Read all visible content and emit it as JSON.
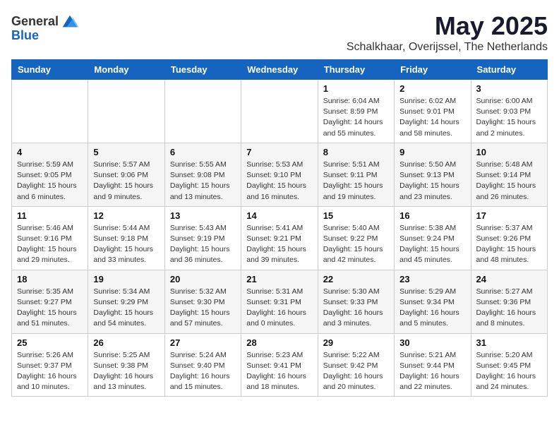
{
  "header": {
    "logo_general": "General",
    "logo_blue": "Blue",
    "month": "May 2025",
    "location": "Schalkhaar, Overijssel, The Netherlands"
  },
  "weekdays": [
    "Sunday",
    "Monday",
    "Tuesday",
    "Wednesday",
    "Thursday",
    "Friday",
    "Saturday"
  ],
  "weeks": [
    [
      {
        "day": "",
        "info": ""
      },
      {
        "day": "",
        "info": ""
      },
      {
        "day": "",
        "info": ""
      },
      {
        "day": "",
        "info": ""
      },
      {
        "day": "1",
        "info": "Sunrise: 6:04 AM\nSunset: 8:59 PM\nDaylight: 14 hours\nand 55 minutes."
      },
      {
        "day": "2",
        "info": "Sunrise: 6:02 AM\nSunset: 9:01 PM\nDaylight: 14 hours\nand 58 minutes."
      },
      {
        "day": "3",
        "info": "Sunrise: 6:00 AM\nSunset: 9:03 PM\nDaylight: 15 hours\nand 2 minutes."
      }
    ],
    [
      {
        "day": "4",
        "info": "Sunrise: 5:59 AM\nSunset: 9:05 PM\nDaylight: 15 hours\nand 6 minutes."
      },
      {
        "day": "5",
        "info": "Sunrise: 5:57 AM\nSunset: 9:06 PM\nDaylight: 15 hours\nand 9 minutes."
      },
      {
        "day": "6",
        "info": "Sunrise: 5:55 AM\nSunset: 9:08 PM\nDaylight: 15 hours\nand 13 minutes."
      },
      {
        "day": "7",
        "info": "Sunrise: 5:53 AM\nSunset: 9:10 PM\nDaylight: 15 hours\nand 16 minutes."
      },
      {
        "day": "8",
        "info": "Sunrise: 5:51 AM\nSunset: 9:11 PM\nDaylight: 15 hours\nand 19 minutes."
      },
      {
        "day": "9",
        "info": "Sunrise: 5:50 AM\nSunset: 9:13 PM\nDaylight: 15 hours\nand 23 minutes."
      },
      {
        "day": "10",
        "info": "Sunrise: 5:48 AM\nSunset: 9:14 PM\nDaylight: 15 hours\nand 26 minutes."
      }
    ],
    [
      {
        "day": "11",
        "info": "Sunrise: 5:46 AM\nSunset: 9:16 PM\nDaylight: 15 hours\nand 29 minutes."
      },
      {
        "day": "12",
        "info": "Sunrise: 5:44 AM\nSunset: 9:18 PM\nDaylight: 15 hours\nand 33 minutes."
      },
      {
        "day": "13",
        "info": "Sunrise: 5:43 AM\nSunset: 9:19 PM\nDaylight: 15 hours\nand 36 minutes."
      },
      {
        "day": "14",
        "info": "Sunrise: 5:41 AM\nSunset: 9:21 PM\nDaylight: 15 hours\nand 39 minutes."
      },
      {
        "day": "15",
        "info": "Sunrise: 5:40 AM\nSunset: 9:22 PM\nDaylight: 15 hours\nand 42 minutes."
      },
      {
        "day": "16",
        "info": "Sunrise: 5:38 AM\nSunset: 9:24 PM\nDaylight: 15 hours\nand 45 minutes."
      },
      {
        "day": "17",
        "info": "Sunrise: 5:37 AM\nSunset: 9:26 PM\nDaylight: 15 hours\nand 48 minutes."
      }
    ],
    [
      {
        "day": "18",
        "info": "Sunrise: 5:35 AM\nSunset: 9:27 PM\nDaylight: 15 hours\nand 51 minutes."
      },
      {
        "day": "19",
        "info": "Sunrise: 5:34 AM\nSunset: 9:29 PM\nDaylight: 15 hours\nand 54 minutes."
      },
      {
        "day": "20",
        "info": "Sunrise: 5:32 AM\nSunset: 9:30 PM\nDaylight: 15 hours\nand 57 minutes."
      },
      {
        "day": "21",
        "info": "Sunrise: 5:31 AM\nSunset: 9:31 PM\nDaylight: 16 hours\nand 0 minutes."
      },
      {
        "day": "22",
        "info": "Sunrise: 5:30 AM\nSunset: 9:33 PM\nDaylight: 16 hours\nand 3 minutes."
      },
      {
        "day": "23",
        "info": "Sunrise: 5:29 AM\nSunset: 9:34 PM\nDaylight: 16 hours\nand 5 minutes."
      },
      {
        "day": "24",
        "info": "Sunrise: 5:27 AM\nSunset: 9:36 PM\nDaylight: 16 hours\nand 8 minutes."
      }
    ],
    [
      {
        "day": "25",
        "info": "Sunrise: 5:26 AM\nSunset: 9:37 PM\nDaylight: 16 hours\nand 10 minutes."
      },
      {
        "day": "26",
        "info": "Sunrise: 5:25 AM\nSunset: 9:38 PM\nDaylight: 16 hours\nand 13 minutes."
      },
      {
        "day": "27",
        "info": "Sunrise: 5:24 AM\nSunset: 9:40 PM\nDaylight: 16 hours\nand 15 minutes."
      },
      {
        "day": "28",
        "info": "Sunrise: 5:23 AM\nSunset: 9:41 PM\nDaylight: 16 hours\nand 18 minutes."
      },
      {
        "day": "29",
        "info": "Sunrise: 5:22 AM\nSunset: 9:42 PM\nDaylight: 16 hours\nand 20 minutes."
      },
      {
        "day": "30",
        "info": "Sunrise: 5:21 AM\nSunset: 9:44 PM\nDaylight: 16 hours\nand 22 minutes."
      },
      {
        "day": "31",
        "info": "Sunrise: 5:20 AM\nSunset: 9:45 PM\nDaylight: 16 hours\nand 24 minutes."
      }
    ]
  ]
}
